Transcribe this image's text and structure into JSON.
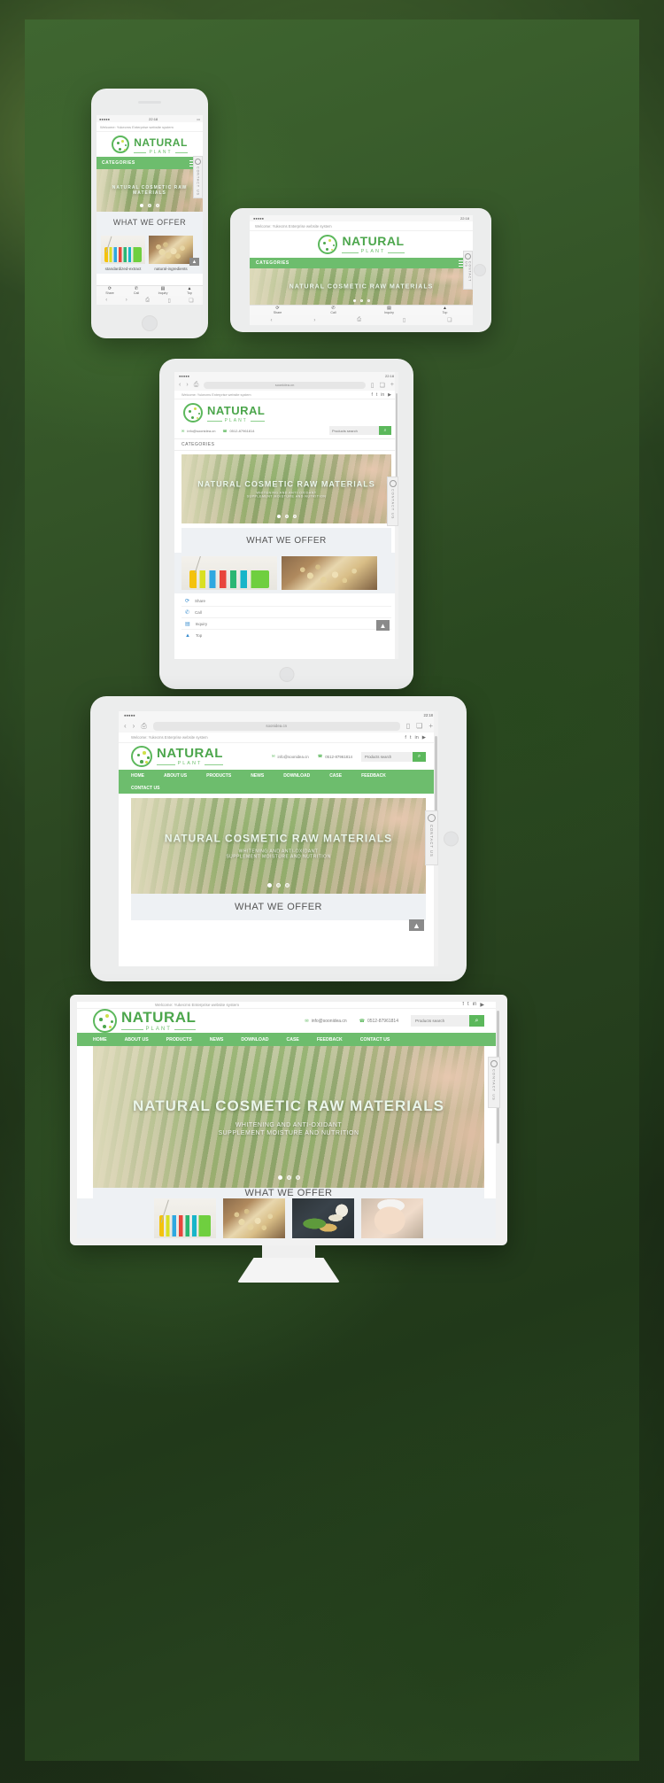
{
  "site": {
    "welcome": "Welcome: Yukecms Enterprise website system",
    "brand": {
      "name": "NATURAL",
      "sub": "PLANT"
    },
    "contacts": {
      "email": "info@soonidea.cn",
      "phone": "0512-87961814"
    },
    "search": {
      "placeholder": "Products search",
      "icon": "search-icon"
    },
    "socials": [
      "facebook-icon",
      "twitter-icon",
      "linkedin-icon",
      "youtube-icon"
    ],
    "nav": [
      {
        "label": "HOME",
        "caret": false
      },
      {
        "label": "ABOUT US",
        "caret": false
      },
      {
        "label": "PRODUCTS",
        "caret": true
      },
      {
        "label": "NEWS",
        "caret": true
      },
      {
        "label": "DOWNLOAD",
        "caret": true
      },
      {
        "label": "CASE",
        "caret": true
      },
      {
        "label": "FEEDBACK",
        "caret": false
      },
      {
        "label": "CONTACT US",
        "caret": false
      }
    ],
    "categories_label": "CATEGORIES",
    "hero": {
      "title": "NATURAL COSMETIC RAW MATERIALS",
      "line1": "WHITENING AND ANTI-OXIDANT",
      "line2": "SUPPLEMENT MOISTURE AND NUTRITION",
      "slides": 3,
      "active_slide": 1
    },
    "section_title": "WHAT WE OFFER",
    "products": [
      {
        "caption": "standardized-extract",
        "thumb": "lab-glassware"
      },
      {
        "caption": "natural-ingredients",
        "thumb": "soy-beans-spoon"
      },
      {
        "caption": "",
        "thumb": "herbal-supplements"
      },
      {
        "caption": "",
        "thumb": "skincare-face"
      }
    ],
    "side_tab": {
      "label": "CONTACT US",
      "icon": "chat-bubble-icon"
    },
    "to_top": {
      "icon": "caret-up-icon"
    },
    "app_toolbar": [
      {
        "label": "Share",
        "icon": "share-icon"
      },
      {
        "label": "Call",
        "icon": "phone-icon"
      },
      {
        "label": "Inquiry",
        "icon": "list-icon"
      },
      {
        "label": "Top",
        "icon": "caret-up-icon"
      }
    ],
    "quick_links": [
      {
        "label": "Share",
        "icon": "share-icon"
      },
      {
        "label": "Call",
        "icon": "phone-icon"
      },
      {
        "label": "Inquiry",
        "icon": "list-icon"
      },
      {
        "label": "Top",
        "icon": "caret-up-icon"
      }
    ]
  },
  "browser": {
    "status_time": "22:18",
    "carrier_dots": "●●●●●",
    "url_text": "soonidea.cn",
    "back_icon": "chevron-left-icon",
    "forward_icon": "chevron-right-icon",
    "share_icon": "share-box-icon",
    "bookmarks_icon": "book-icon",
    "tabs_icon": "tabs-icon",
    "plus_icon": "plus-icon"
  },
  "devices": [
    {
      "name": "iphone-portrait"
    },
    {
      "name": "ipad-landscape-small"
    },
    {
      "name": "ipad-portrait"
    },
    {
      "name": "ipad-landscape-large"
    },
    {
      "name": "imac-desktop"
    }
  ],
  "colors": {
    "brand_green": "#5cb85c",
    "nav_green": "#6dbd6d",
    "section_bg": "#eef1f4",
    "backdrop_green": "#2e4a22"
  }
}
